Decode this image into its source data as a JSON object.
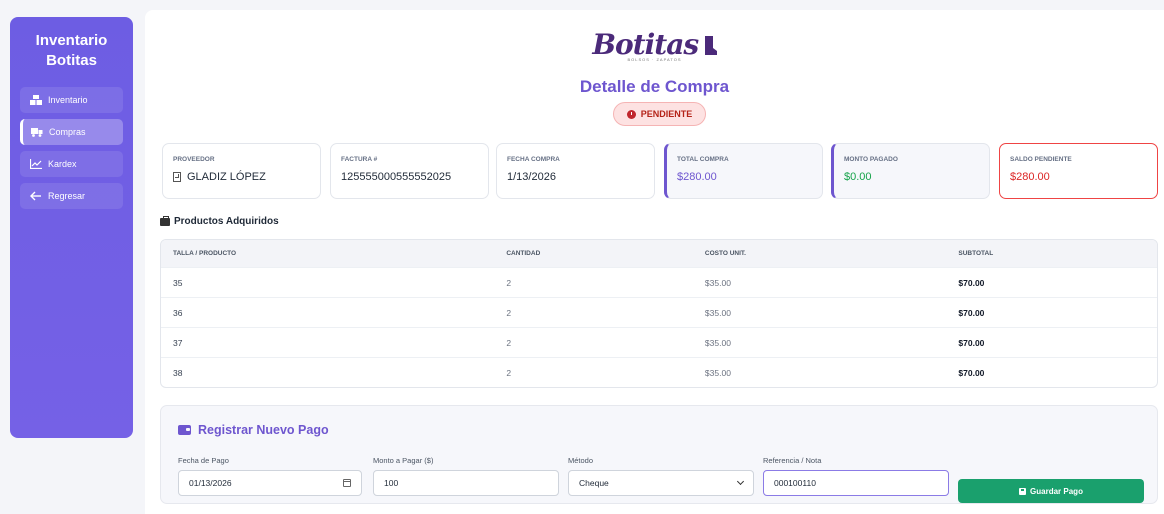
{
  "sidebar": {
    "brand_line1": "Inventario",
    "brand_line2": "Botitas",
    "items": [
      {
        "label": "Inventario",
        "icon": "boxes-icon",
        "active": false
      },
      {
        "label": "Compras",
        "icon": "truck-icon",
        "active": true
      },
      {
        "label": "Kardex",
        "icon": "chart-line-icon",
        "active": false
      },
      {
        "label": "Regresar",
        "icon": "arrow-left-icon",
        "active": false
      }
    ]
  },
  "header": {
    "logo_text": "Botitas",
    "logo_sub": "BOLSOS · ZAPATOS",
    "title": "Detalle de Compra",
    "status": "PENDIENTE"
  },
  "cards": [
    {
      "label": "PROVEEDOR",
      "value": "GLADIZ LÓPEZ"
    },
    {
      "label": "FACTURA #",
      "value": "125555000555552025"
    },
    {
      "label": "FECHA COMPRA",
      "value": "1/13/2026"
    },
    {
      "label": "TOTAL COMPRA",
      "value": "$280.00"
    },
    {
      "label": "MONTO PAGADO",
      "value": "$0.00"
    },
    {
      "label": "SALDO PENDIENTE",
      "value": "$280.00"
    }
  ],
  "products": {
    "title": "Productos Adquiridos",
    "headers": [
      "TALLA / PRODUCTO",
      "CANTIDAD",
      "COSTO UNIT.",
      "SUBTOTAL"
    ],
    "rows": [
      [
        "35",
        "2",
        "$35.00",
        "$70.00"
      ],
      [
        "36",
        "2",
        "$35.00",
        "$70.00"
      ],
      [
        "37",
        "2",
        "$35.00",
        "$70.00"
      ],
      [
        "38",
        "2",
        "$35.00",
        "$70.00"
      ]
    ]
  },
  "payment": {
    "title": "Registrar Nuevo Pago",
    "date_label": "Fecha de Pago",
    "date_value": "01/13/2026",
    "amount_label": "Monto a Pagar ($)",
    "amount_value": "100",
    "method_label": "Método",
    "method_value": "Cheque",
    "ref_label": "Referencia / Nota",
    "ref_value": "000100110",
    "save_label": "Guardar Pago"
  },
  "colors": {
    "accent": "#6e56cf",
    "success": "#1aa06d",
    "danger": "#dc2626"
  }
}
